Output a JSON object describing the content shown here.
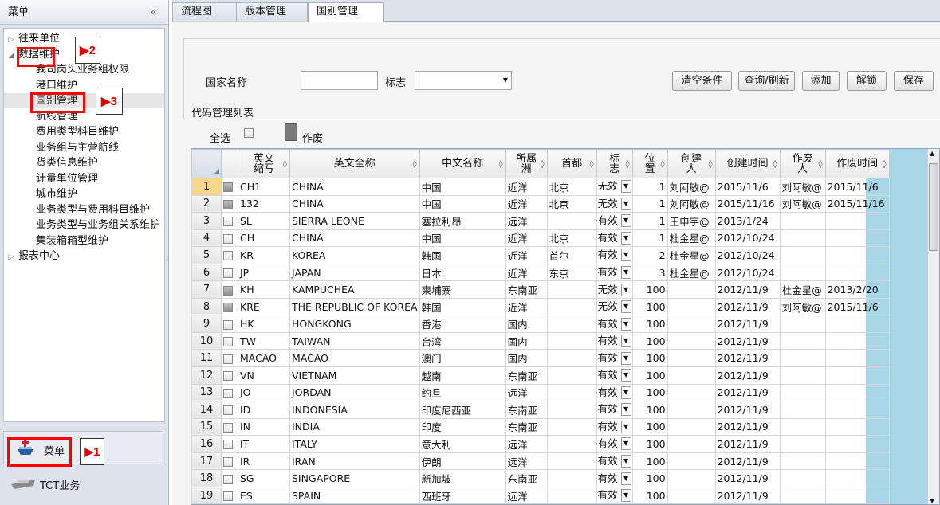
{
  "menu": {
    "title": "菜单",
    "collapse_glyph": "«",
    "tree": [
      {
        "label": "往来单位",
        "level": 0
      },
      {
        "label": "数据维护",
        "level": 0,
        "expanded": true
      },
      {
        "label": "我司岗头业务组权限",
        "level": 1
      },
      {
        "label": "港口维护",
        "level": 1
      },
      {
        "label": "国别管理",
        "level": 1,
        "selected": true
      },
      {
        "label": "航线管理",
        "level": 1
      },
      {
        "label": "费用类型科目维护",
        "level": 1
      },
      {
        "label": "业务组与主营航线",
        "level": 1
      },
      {
        "label": "货类信息维护",
        "level": 1
      },
      {
        "label": "计量单位管理",
        "level": 1
      },
      {
        "label": "城市维护",
        "level": 1
      },
      {
        "label": "业务类型与费用科目维护",
        "level": 1
      },
      {
        "label": "业务类型与业务组关系维护",
        "level": 1
      },
      {
        "label": "集装箱箱型维护",
        "level": 1
      },
      {
        "label": "报表中心",
        "level": 0
      }
    ],
    "nav": [
      {
        "label": "菜单",
        "icon": "ship-icon"
      },
      {
        "label": "TCT业务",
        "icon": "ship-icon"
      }
    ]
  },
  "markers": {
    "m1": "▶1",
    "m2": "▶2",
    "m3": "▶3"
  },
  "tabs": [
    "流程图",
    "版本管理",
    "国别管理"
  ],
  "tab_close": "✕",
  "filters": {
    "country_label": "国家名称",
    "country_value": "",
    "flag_label": "标志",
    "flag_value": ""
  },
  "buttons": {
    "clear": "清空条件",
    "query": "查询/刷新",
    "add": "添加",
    "unlock": "解锁",
    "save": "保存"
  },
  "list": {
    "title": "代码管理列表",
    "select_all": "全选",
    "void": "作废",
    "columns": [
      "英文\n缩写",
      "英文全称",
      "中文名称",
      "所属\n洲",
      "首都",
      "标\n志",
      "位\n置",
      "创建\n人",
      "创建时间",
      "作废\n人",
      "作废时间"
    ],
    "rows": [
      [
        "CH1",
        "CHINA",
        "中国",
        "近洋",
        "北京",
        "无效",
        "1",
        "刘阿敏@",
        "2015/11/6",
        "刘阿敏@",
        "2015/11/6"
      ],
      [
        "132",
        "CHINA",
        "中国",
        "近洋",
        "北京",
        "无效",
        "1",
        "刘阿敏@",
        "2015/11/16",
        "刘阿敏@",
        "2015/11/16"
      ],
      [
        "SL",
        "SIERRA LEONE",
        "塞拉利昂",
        "远洋",
        "",
        "有效",
        "1",
        "王申宇@",
        "2013/1/24",
        "",
        ""
      ],
      [
        "CH",
        "CHINA",
        "中国",
        "近洋",
        "北京",
        "有效",
        "1",
        "杜金星@",
        "2012/10/24",
        "",
        ""
      ],
      [
        "KR",
        "KOREA",
        "韩国",
        "近洋",
        "首尔",
        "有效",
        "2",
        "杜金星@",
        "2012/10/24",
        "",
        ""
      ],
      [
        "JP",
        "JAPAN",
        "日本",
        "近洋",
        "东京",
        "有效",
        "3",
        "杜金星@",
        "2012/10/24",
        "",
        ""
      ],
      [
        "KH",
        "KAMPUCHEA",
        "柬埔寨",
        "东南亚",
        "",
        "无效",
        "100",
        "",
        "2012/11/9",
        "杜金星@",
        "2013/2/20"
      ],
      [
        "KRE",
        "THE REPUBLIC OF KOREA",
        "韩国",
        "近洋",
        "",
        "无效",
        "100",
        "",
        "2012/11/9",
        "刘阿敏@",
        "2015/11/6"
      ],
      [
        "HK",
        "HONGKONG",
        "香港",
        "国内",
        "",
        "有效",
        "100",
        "",
        "2012/11/9",
        "",
        ""
      ],
      [
        "TW",
        "TAIWAN",
        "台湾",
        "国内",
        "",
        "有效",
        "100",
        "",
        "2012/11/9",
        "",
        ""
      ],
      [
        "MACAO",
        "MACAO",
        "澳门",
        "国内",
        "",
        "有效",
        "100",
        "",
        "2012/11/9",
        "",
        ""
      ],
      [
        "VN",
        "VIETNAM",
        "越南",
        "东南亚",
        "",
        "有效",
        "100",
        "",
        "2012/11/9",
        "",
        ""
      ],
      [
        "JO",
        "JORDAN",
        "约旦",
        "远洋",
        "",
        "有效",
        "100",
        "",
        "2012/11/9",
        "",
        ""
      ],
      [
        "ID",
        "INDONESIA",
        "印度尼西亚",
        "东南亚",
        "",
        "有效",
        "100",
        "",
        "2012/11/9",
        "",
        ""
      ],
      [
        "IN",
        "INDIA",
        "印度",
        "东南亚",
        "",
        "有效",
        "100",
        "",
        "2012/11/9",
        "",
        ""
      ],
      [
        "IT",
        "ITALY",
        "意大利",
        "远洋",
        "",
        "有效",
        "100",
        "",
        "2012/11/9",
        "",
        ""
      ],
      [
        "IR",
        "IRAN",
        "伊朗",
        "远洋",
        "",
        "有效",
        "100",
        "",
        "2012/11/9",
        "",
        ""
      ],
      [
        "SG",
        "SINGAPORE",
        "新加坡",
        "东南亚",
        "",
        "有效",
        "100",
        "",
        "2012/11/9",
        "",
        ""
      ],
      [
        "ES",
        "SPAIN",
        "西班牙",
        "远洋",
        "",
        "有效",
        "100",
        "",
        "2012/11/9",
        "",
        ""
      ]
    ]
  }
}
